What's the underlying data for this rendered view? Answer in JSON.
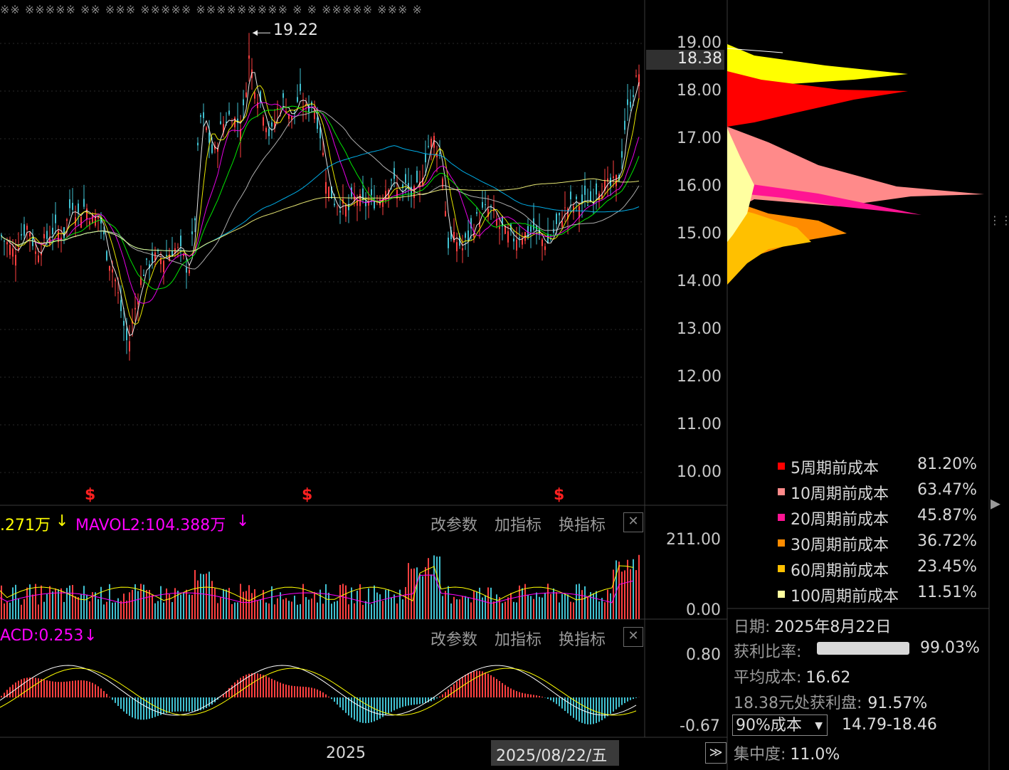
{
  "header": {
    "top_text": "※※ ※※※※※ ※※ ※※※ ※※※※※ ※※※※※※※※※ ※ ※ ※※※※※ ※※※ ※"
  },
  "price_axis": {
    "labels": [
      "19.00",
      "18.00",
      "17.00",
      "16.00",
      "15.00",
      "14.00",
      "13.00",
      "12.00",
      "11.00",
      "10.00"
    ],
    "current": "18.38",
    "peak_label": "19.22"
  },
  "volume_panel": {
    "mavol1": ".271万",
    "mavol1_arrow": "↓",
    "mavol2": "MAVOL2:104.388万",
    "mavol2_arrow": "↓",
    "axis_top": "211.00",
    "axis_bottom": "0.00"
  },
  "macd_panel": {
    "label": "ACD:0.253",
    "arrow": "↓",
    "axis_top": "0.80",
    "axis_bottom": "-0.67"
  },
  "panel_buttons": {
    "params": "改参数",
    "add": "加指标",
    "switch": "换指标",
    "close": "✕"
  },
  "footer": {
    "year": "2025",
    "cursor_date": "2025/08/22/五",
    "expand": "≫"
  },
  "signal_marker": "$",
  "chip_legend": [
    {
      "name": "5周期前成本",
      "pct": "81.20%",
      "color": "#ff0000"
    },
    {
      "name": "10周期前成本",
      "pct": "63.47%",
      "color": "#ff8a8a"
    },
    {
      "name": "20周期前成本",
      "pct": "45.87%",
      "color": "#ff1493"
    },
    {
      "name": "30周期前成本",
      "pct": "36.72%",
      "color": "#ff8c00"
    },
    {
      "name": "60周期前成本",
      "pct": "23.45%",
      "color": "#ffc000"
    },
    {
      "name": "100周期前成本",
      "pct": "11.51%",
      "color": "#ffffa0"
    }
  ],
  "chip_info": {
    "date_label": "日期:",
    "date": "2025年8月22日",
    "profit_label": "获利比率:",
    "profit_pct": "99.03%",
    "avg_label": "平均成本:",
    "avg": "16.62",
    "at_price_label": "18.38元处获利盘:",
    "at_price_pct": "91.57%",
    "cost_select": "90%成本",
    "cost_range": "14.79-18.46",
    "conc_label": "集中度:",
    "conc": "11.0%"
  },
  "colors": {
    "up": "#ff4040",
    "down": "#40c0d0",
    "ma5": "#ffffff",
    "ma10": "#ffff00",
    "ma20": "#ff00ff",
    "ma30": "#00ff00",
    "ma60": "#c0c0c0",
    "ma120": "#00bfff",
    "ma250": "#ffff80"
  }
}
